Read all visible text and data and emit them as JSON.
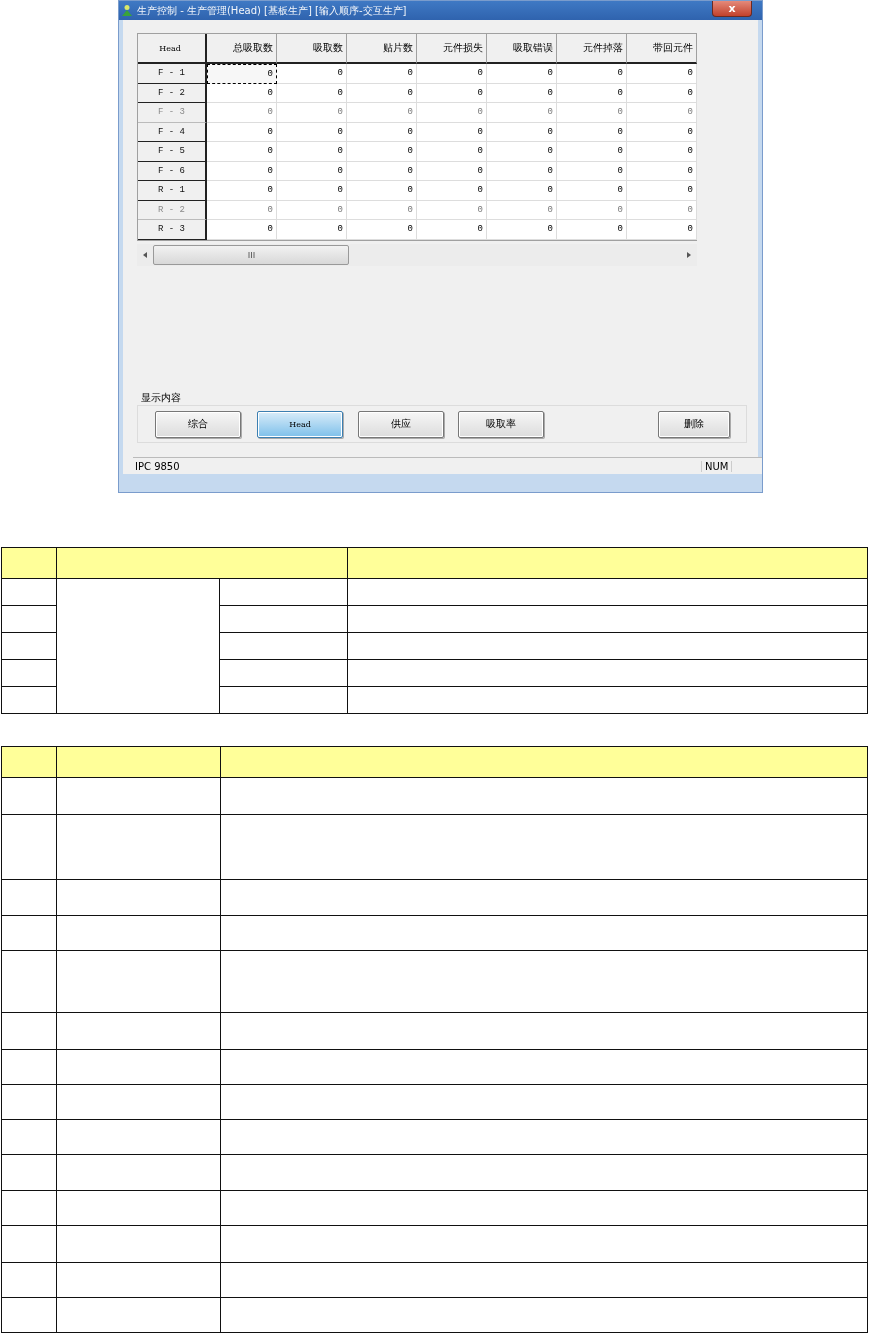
{
  "window": {
    "title": "生产控制 - 生产管理(Head) [基板生产] [输入顺序-交互生产]",
    "close": "x"
  },
  "grid": {
    "corner": "Head",
    "columns": [
      "总吸取数",
      "吸取数",
      "贴片数",
      "元件损失",
      "吸取错误",
      "元件掉落",
      "带回元件"
    ],
    "rows": [
      {
        "label": "F - 1",
        "dimmed": false,
        "focused": true,
        "cells": [
          "0",
          "0",
          "0",
          "0",
          "0",
          "0",
          "0"
        ]
      },
      {
        "label": "F - 2",
        "dimmed": false,
        "focused": false,
        "cells": [
          "0",
          "0",
          "0",
          "0",
          "0",
          "0",
          "0"
        ]
      },
      {
        "label": "F - 3",
        "dimmed": true,
        "focused": false,
        "cells": [
          "0",
          "0",
          "0",
          "0",
          "0",
          "0",
          "0"
        ]
      },
      {
        "label": "F - 4",
        "dimmed": false,
        "focused": false,
        "cells": [
          "0",
          "0",
          "0",
          "0",
          "0",
          "0",
          "0"
        ]
      },
      {
        "label": "F - 5",
        "dimmed": false,
        "focused": false,
        "cells": [
          "0",
          "0",
          "0",
          "0",
          "0",
          "0",
          "0"
        ]
      },
      {
        "label": "F - 6",
        "dimmed": false,
        "focused": false,
        "cells": [
          "0",
          "0",
          "0",
          "0",
          "0",
          "0",
          "0"
        ]
      },
      {
        "label": "R - 1",
        "dimmed": false,
        "focused": false,
        "cells": [
          "0",
          "0",
          "0",
          "0",
          "0",
          "0",
          "0"
        ]
      },
      {
        "label": "R - 2",
        "dimmed": true,
        "focused": false,
        "cells": [
          "0",
          "0",
          "0",
          "0",
          "0",
          "0",
          "0"
        ]
      },
      {
        "label": "R - 3",
        "dimmed": false,
        "focused": false,
        "cells": [
          "0",
          "0",
          "0",
          "0",
          "0",
          "0",
          "0"
        ]
      }
    ]
  },
  "display_group": {
    "label": "显示内容",
    "buttons": [
      {
        "label": "综合",
        "selected": false
      },
      {
        "label": "Head",
        "selected": true
      },
      {
        "label": "供应",
        "selected": false
      },
      {
        "label": "吸取率",
        "selected": false
      }
    ],
    "delete_button": "删除"
  },
  "status_bar": {
    "left": "IPC 9850",
    "indicator": "NUM"
  }
}
